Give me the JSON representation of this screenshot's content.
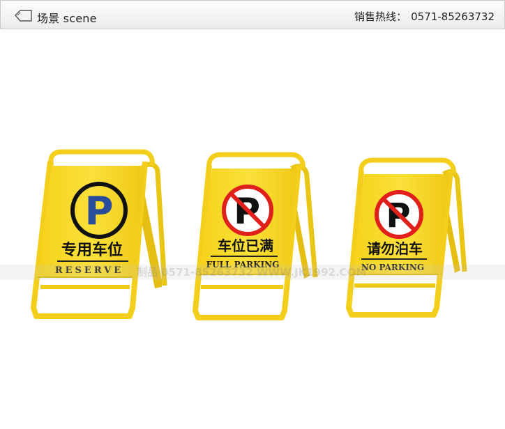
{
  "header": {
    "title": "场景 scene",
    "hotline_label": "销售热线：",
    "hotline_number": "0571-85263732"
  },
  "signs": [
    {
      "cn_text": "专用车位",
      "en_text": "RESERVE",
      "symbol": "parking-allowed-icon"
    },
    {
      "cn_text": "车位已满",
      "en_text": "FULL PARKING",
      "symbol": "no-parking-icon"
    },
    {
      "cn_text": "请勿泊车",
      "en_text": "NO PARKING",
      "symbol": "no-parking-icon"
    }
  ],
  "watermark": {
    "text": "制品 0571-85263732 WWW.JK1992.COM"
  },
  "colors": {
    "sign_yellow": "#f7d71f",
    "sign_dark_yellow": "#d9b400",
    "parking_blue": "#2a4c9c",
    "prohibit_red": "#e0201b"
  }
}
